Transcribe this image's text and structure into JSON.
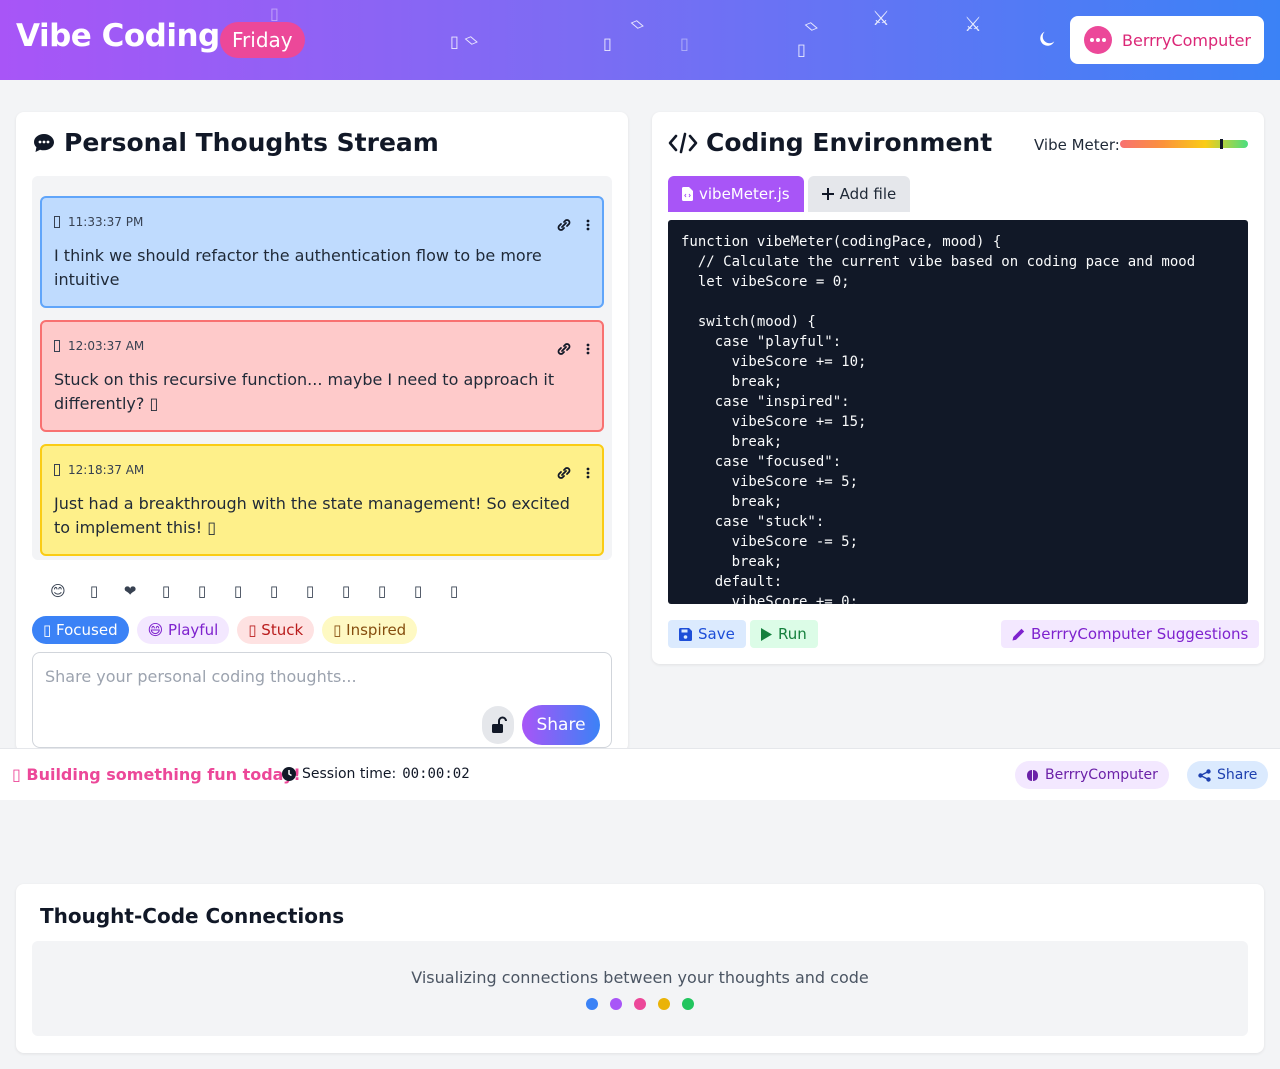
{
  "header": {
    "brand": "Vibe Coding",
    "day": "Friday",
    "user_name": "BerrryComputer"
  },
  "thoughts_panel": {
    "title": "Personal Thoughts Stream",
    "thoughts": [
      {
        "time": "11:33:37 PM",
        "text": "I think we should refactor the authentication flow to be more intuitive",
        "mood": "focused"
      },
      {
        "time": "12:03:37 AM",
        "text": "Stuck on this recursive function... maybe I need to approach it differently? ▯",
        "mood": "stuck"
      },
      {
        "time": "12:18:37 AM",
        "text": "Just had a breakthrough with the state management! So excited to implement this! ▯",
        "mood": "inspired"
      }
    ],
    "emojis": [
      "😊",
      "▯",
      "❤",
      "▯",
      "▯",
      "▯",
      "▯",
      "▯",
      "▯",
      "▯",
      "▯",
      "▯"
    ],
    "moods": [
      {
        "label": "▯ Focused",
        "key": "focused"
      },
      {
        "label": "😄 Playful",
        "key": "playful"
      },
      {
        "label": "▯ Stuck",
        "key": "stuck"
      },
      {
        "label": "▯ Inspired",
        "key": "inspired"
      }
    ],
    "input_placeholder": "Share your personal coding thoughts...",
    "share_label": "Share"
  },
  "code_panel": {
    "title": "Coding Environment",
    "vibe_label": "Vibe Meter:",
    "vibe_level": 0.78,
    "tabs": [
      {
        "label": "vibeMeter.js",
        "active": true
      },
      {
        "label": "Add file",
        "active": false
      }
    ],
    "code": "function vibeMeter(codingPace, mood) {\n  // Calculate the current vibe based on coding pace and mood\n  let vibeScore = 0;\n\n  switch(mood) {\n    case \"playful\":\n      vibeScore += 10;\n      break;\n    case \"inspired\":\n      vibeScore += 15;\n      break;\n    case \"focused\":\n      vibeScore += 5;\n      break;\n    case \"stuck\":\n      vibeScore -= 5;\n      break;\n    default:\n      vibeScore += 0;",
    "save_label": "Save",
    "run_label": "Run",
    "suggestions_label": "BerrryComputer Suggestions"
  },
  "statusbar": {
    "message": "▯ Building something fun today!",
    "session_label": "Session time:",
    "session_time": "00:00:02",
    "brain_label": "BerrryComputer",
    "share_label": "Share"
  },
  "connections": {
    "title": "Thought-Code Connections",
    "text": "Visualizing connections between your thoughts and code",
    "dot_colors": [
      "#3b82f6",
      "#a855f7",
      "#ec4899",
      "#eab308",
      "#22c55e"
    ]
  }
}
